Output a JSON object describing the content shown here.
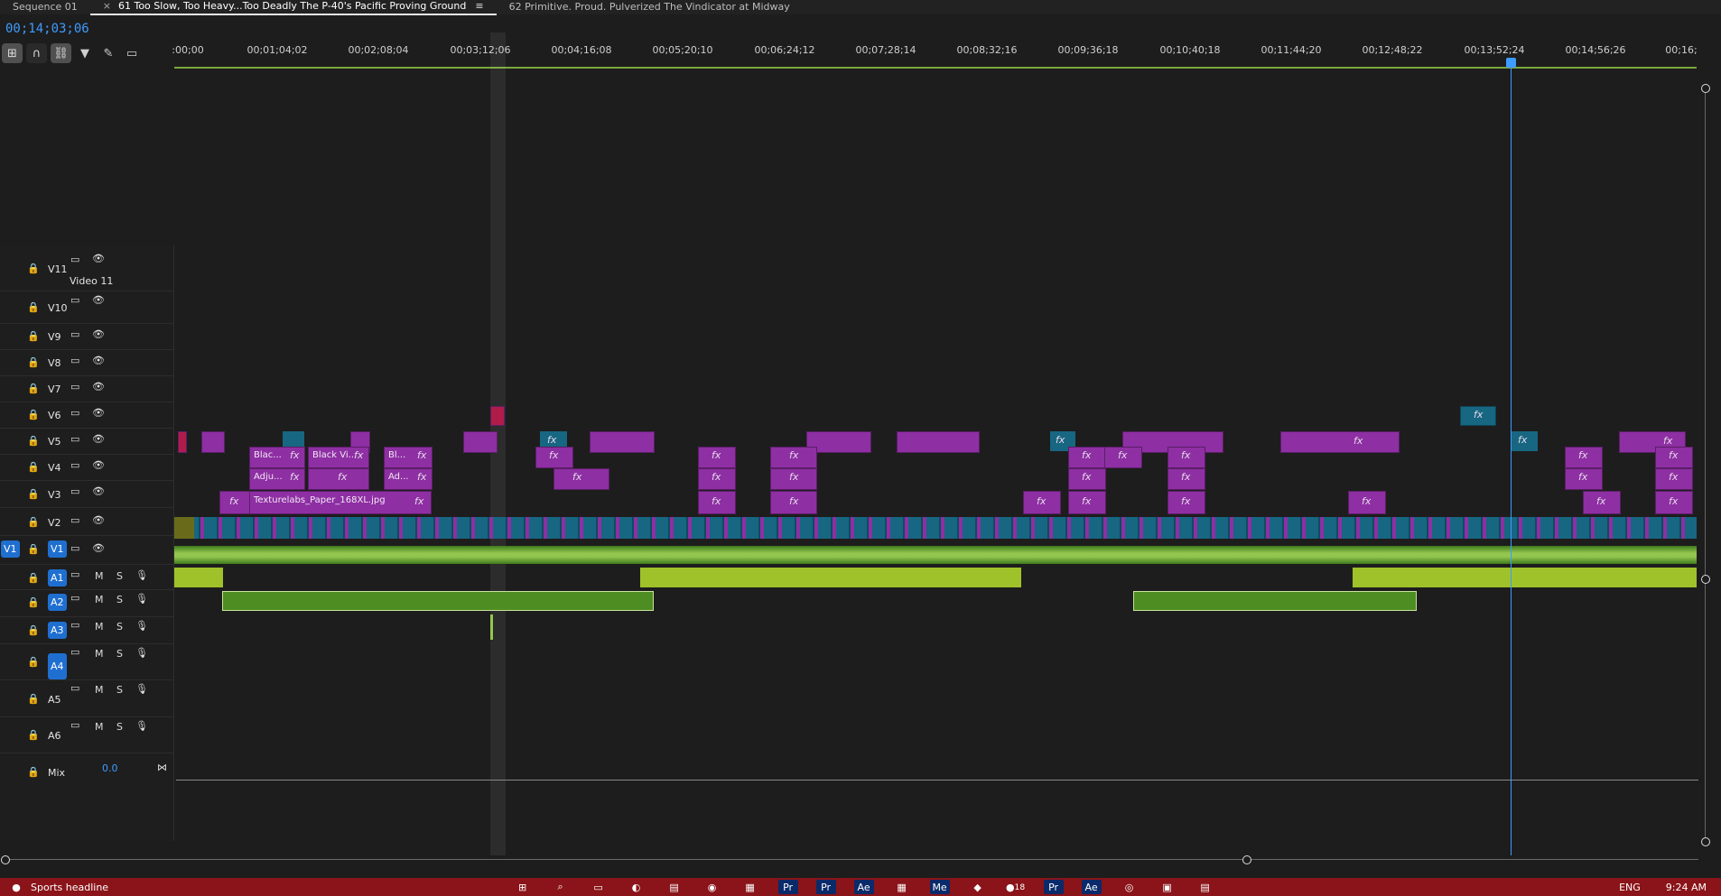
{
  "tabs": [
    {
      "label": "Sequence 01",
      "active": false
    },
    {
      "label": "61 Too Slow, Too Heavy...Too Deadly The P-40's Pacific Proving Ground",
      "active": true
    },
    {
      "label": "62 Primitive. Proud. Pulverized The Vindicator at Midway",
      "active": false
    }
  ],
  "timecode": "00;14;03;06",
  "ruler_labels": [
    ":00;00",
    "00;01;04;02",
    "00;02;08;04",
    "00;03;12;06",
    "00;04;16;08",
    "00;05;20;10",
    "00;06;24;12",
    "00;07;28;14",
    "00;08;32;16",
    "00;09;36;18",
    "00;10;40;18",
    "00;11;44;20",
    "00;12;48;22",
    "00;13;52;24",
    "00;14;56;26",
    "00;16;"
  ],
  "tracks": {
    "video": [
      {
        "id": "V11",
        "name": "Video 11"
      },
      {
        "id": "V10"
      },
      {
        "id": "V9"
      },
      {
        "id": "V8"
      },
      {
        "id": "V7"
      },
      {
        "id": "V6"
      },
      {
        "id": "V5"
      },
      {
        "id": "V4"
      },
      {
        "id": "V3"
      },
      {
        "id": "V2"
      },
      {
        "id": "V1"
      }
    ],
    "audio": [
      {
        "id": "A1"
      },
      {
        "id": "A2"
      },
      {
        "id": "A3"
      },
      {
        "id": "A4"
      },
      {
        "id": "A5"
      },
      {
        "id": "A6"
      }
    ],
    "mix": {
      "label": "Mix",
      "value": "0.0"
    }
  },
  "clip_labels": {
    "v4": [
      "Blac...",
      "Black Vi...",
      "Bl..."
    ],
    "v3": [
      "Adju...",
      "Ad..."
    ],
    "v2": [
      "Texturelabs_Paper_168XL.jpg"
    ],
    "fx": "fx"
  },
  "source_patch": "V1",
  "toggles": {
    "m": "M",
    "s": "S"
  },
  "taskbar": {
    "news": "Sports headline",
    "lang": "ENG",
    "time": "9:24 AM",
    "badge": "18"
  },
  "colors": {
    "accent": "#3e9bff",
    "video_clip": "#8e2fa3",
    "video_clip_alt": "#176682",
    "audio_clip": "#93c64f",
    "taskbar": "#8a1419"
  }
}
